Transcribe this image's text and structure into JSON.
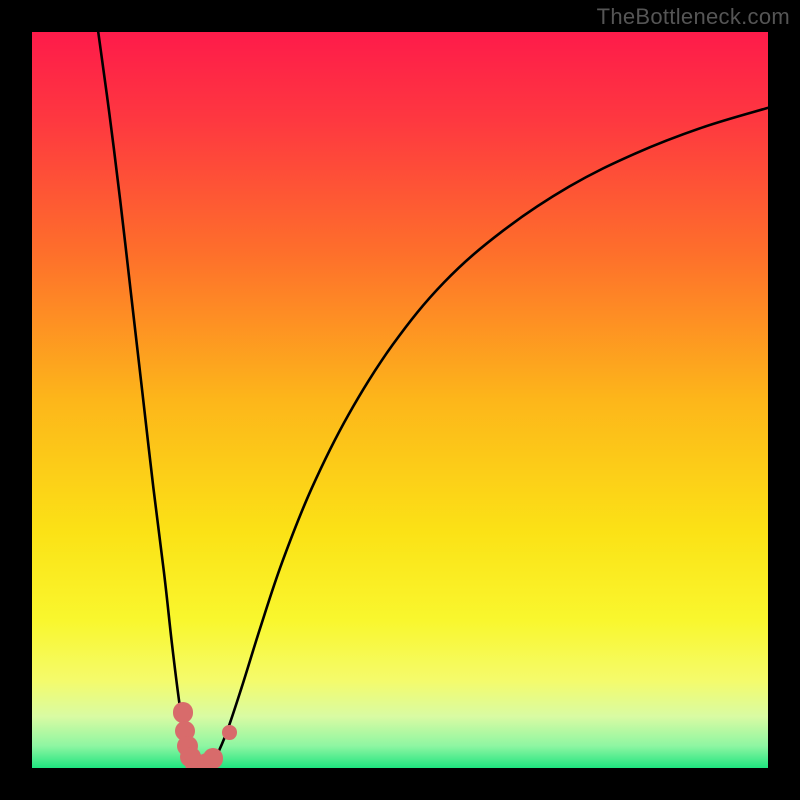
{
  "watermark": "TheBottleneck.com",
  "colors": {
    "frame_bg": "#000000",
    "gradient_stops": [
      {
        "offset": 0.0,
        "color": "#fe1b4a"
      },
      {
        "offset": 0.12,
        "color": "#fe3840"
      },
      {
        "offset": 0.3,
        "color": "#fe6f2b"
      },
      {
        "offset": 0.5,
        "color": "#fdb61a"
      },
      {
        "offset": 0.68,
        "color": "#fbe216"
      },
      {
        "offset": 0.8,
        "color": "#f9f72e"
      },
      {
        "offset": 0.88,
        "color": "#f5fb6a"
      },
      {
        "offset": 0.93,
        "color": "#d9fba3"
      },
      {
        "offset": 0.97,
        "color": "#8ef6a2"
      },
      {
        "offset": 1.0,
        "color": "#1fe47f"
      }
    ],
    "curve_stroke": "#000000",
    "marker_fill": "#d86b6b"
  },
  "chart_data": {
    "type": "line",
    "title": "",
    "xlabel": "",
    "ylabel": "",
    "xlim": [
      0,
      100
    ],
    "ylim": [
      0,
      100
    ],
    "grid": false,
    "series": [
      {
        "name": "curve-left",
        "points": [
          {
            "x": 9.0,
            "y": 100.0
          },
          {
            "x": 10.5,
            "y": 89.0
          },
          {
            "x": 12.0,
            "y": 77.0
          },
          {
            "x": 13.5,
            "y": 64.0
          },
          {
            "x": 15.0,
            "y": 51.0
          },
          {
            "x": 16.5,
            "y": 38.0
          },
          {
            "x": 18.0,
            "y": 26.0
          },
          {
            "x": 19.0,
            "y": 17.0
          },
          {
            "x": 20.0,
            "y": 9.0
          },
          {
            "x": 20.8,
            "y": 4.0
          },
          {
            "x": 21.5,
            "y": 1.0
          },
          {
            "x": 22.2,
            "y": 0.0
          }
        ]
      },
      {
        "name": "curve-right",
        "points": [
          {
            "x": 24.0,
            "y": 0.0
          },
          {
            "x": 25.0,
            "y": 1.5
          },
          {
            "x": 26.5,
            "y": 5.0
          },
          {
            "x": 28.5,
            "y": 11.0
          },
          {
            "x": 31.0,
            "y": 19.0
          },
          {
            "x": 34.0,
            "y": 28.0
          },
          {
            "x": 38.0,
            "y": 38.0
          },
          {
            "x": 43.0,
            "y": 48.0
          },
          {
            "x": 49.0,
            "y": 57.5
          },
          {
            "x": 56.0,
            "y": 66.0
          },
          {
            "x": 64.0,
            "y": 73.0
          },
          {
            "x": 73.0,
            "y": 79.0
          },
          {
            "x": 82.0,
            "y": 83.5
          },
          {
            "x": 91.0,
            "y": 87.0
          },
          {
            "x": 100.0,
            "y": 89.7
          }
        ]
      }
    ],
    "markers": [
      {
        "x": 20.5,
        "y": 7.5,
        "r": 1.4
      },
      {
        "x": 20.8,
        "y": 5.0,
        "r": 1.4
      },
      {
        "x": 21.1,
        "y": 3.0,
        "r": 1.4
      },
      {
        "x": 21.5,
        "y": 1.5,
        "r": 1.4
      },
      {
        "x": 22.2,
        "y": 0.6,
        "r": 1.4
      },
      {
        "x": 23.0,
        "y": 0.4,
        "r": 1.4
      },
      {
        "x": 23.8,
        "y": 0.6,
        "r": 1.4
      },
      {
        "x": 24.6,
        "y": 1.3,
        "r": 1.4
      },
      {
        "x": 26.8,
        "y": 4.8,
        "r": 1.0
      }
    ]
  }
}
